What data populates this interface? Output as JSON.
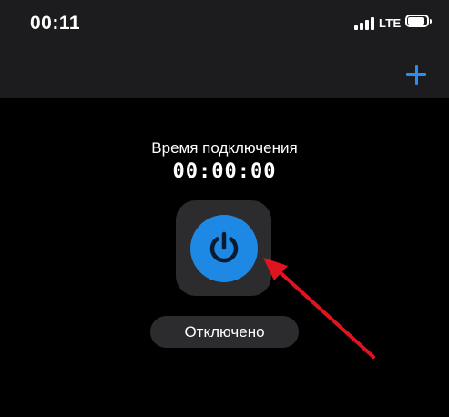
{
  "status_bar": {
    "time": "00:11",
    "network": "LTE",
    "icons": [
      "signal-icon",
      "battery-icon"
    ]
  },
  "toolbar": {
    "add_icon": "plus-icon",
    "accent_color": "#2d8cf0"
  },
  "connection": {
    "label": "Время подключения",
    "duration": "00:00:00",
    "status": "Отключено",
    "power_icon": "power-icon",
    "power_color": "#1e88e5"
  },
  "annotation": {
    "arrow_color": "#e0141e"
  }
}
